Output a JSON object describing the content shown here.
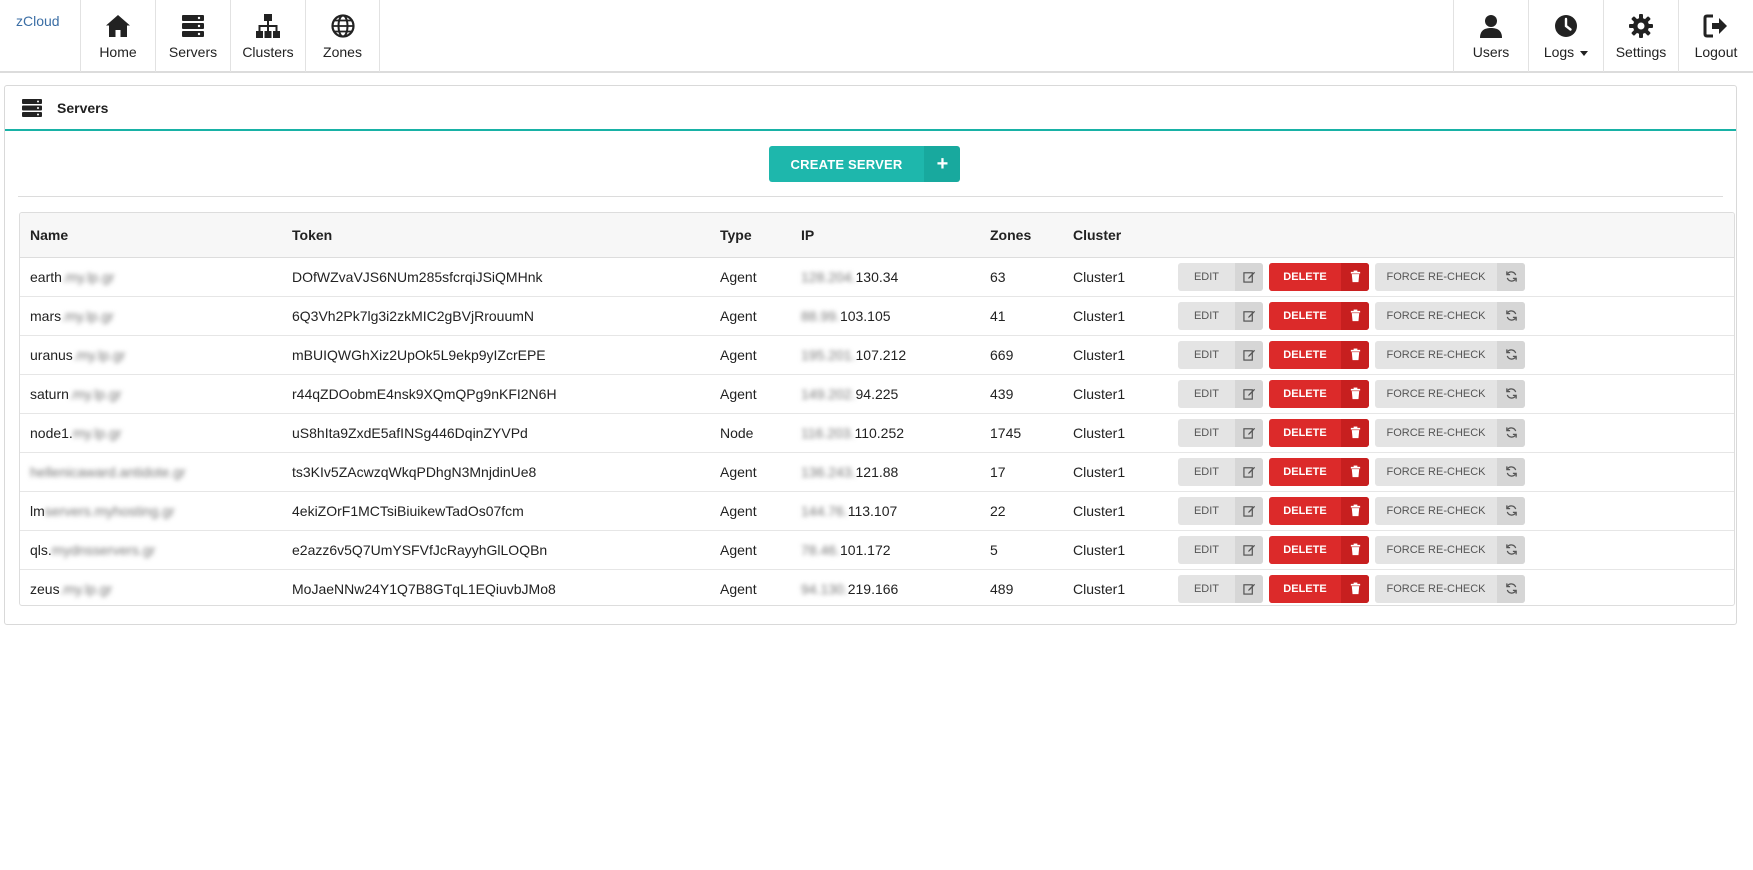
{
  "brand": "zCloud",
  "nav_left": [
    {
      "label": "Home",
      "icon": "home-icon"
    },
    {
      "label": "Servers",
      "icon": "servers-icon"
    },
    {
      "label": "Clusters",
      "icon": "clusters-icon"
    },
    {
      "label": "Zones",
      "icon": "globe-icon"
    }
  ],
  "nav_right": [
    {
      "label": "Users",
      "icon": "user-icon"
    },
    {
      "label": "Logs",
      "icon": "clock-icon"
    },
    {
      "label": "Settings",
      "icon": "gear-icon"
    },
    {
      "label": "Logout",
      "icon": "logout-icon"
    }
  ],
  "panel": {
    "title": "Servers",
    "icon": "servers-icon"
  },
  "create_button": {
    "label": "CREATE SERVER",
    "icon": "plus-icon"
  },
  "table": {
    "headers": [
      "Name",
      "Token",
      "Type",
      "IP",
      "Zones",
      "Cluster"
    ],
    "rows": [
      {
        "name": "earth",
        "name_blur": ".my.lp.gr",
        "token": "DOfWZvaVJS6NUm285sfcrqiJSiQMHnk",
        "type": "Agent",
        "ip_blur": "128.204.",
        "ip": "130.34",
        "zones": "63",
        "cluster": "Cluster1"
      },
      {
        "name": "mars",
        "name_blur": ".my.lp.gr",
        "token": "6Q3Vh2Pk7lg3i2zkMIC2gBVjRrouumN",
        "type": "Agent",
        "ip_blur": "88.99.",
        "ip": "103.105",
        "zones": "41",
        "cluster": "Cluster1"
      },
      {
        "name": "uranus",
        "name_blur": ".my.lp.gr",
        "token": "mBUIQWGhXiz2UpOk5L9ekp9yIZcrEPE",
        "type": "Agent",
        "ip_blur": "195.201.",
        "ip": "107.212",
        "zones": "669",
        "cluster": "Cluster1"
      },
      {
        "name": "saturn",
        "name_blur": ".my.lp.gr",
        "token": "r44qZDOobmE4nsk9XQmQPg9nKFI2N6H",
        "type": "Agent",
        "ip_blur": "149.202.",
        "ip": "94.225",
        "zones": "439",
        "cluster": "Cluster1"
      },
      {
        "name": "node1.",
        "name_blur": "my.lp.gr",
        "token": "uS8hIta9ZxdE5afINSg446DqinZYVPd",
        "type": "Node",
        "ip_blur": "116.203.",
        "ip": "110.252",
        "zones": "1745",
        "cluster": "Cluster1"
      },
      {
        "name": "",
        "name_blur": "hellenicaward.antidote.gr",
        "token": "ts3KIv5ZAcwzqWkqPDhgN3MnjdinUe8",
        "type": "Agent",
        "ip_blur": "136.243.",
        "ip": "121.88",
        "zones": "17",
        "cluster": "Cluster1"
      },
      {
        "name": "lm",
        "name_blur": "servers.myhosting.gr",
        "token": "4ekiZOrF1MCTsiBiuikewTadOs07fcm",
        "type": "Agent",
        "ip_blur": "144.76.",
        "ip": "113.107",
        "zones": "22",
        "cluster": "Cluster1"
      },
      {
        "name": "qls.",
        "name_blur": "mydnsservers.gr",
        "token": "e2azz6v5Q7UmYSFVfJcRayyhGlLOQBn",
        "type": "Agent",
        "ip_blur": "78.46.",
        "ip": "101.172",
        "zones": "5",
        "cluster": "Cluster1"
      },
      {
        "name": "zeus",
        "name_blur": ".my.lp.gr",
        "token": "MoJaeNNw24Y1Q7B8GTqL1EQiuvbJMo8",
        "type": "Agent",
        "ip_blur": "94.130.",
        "ip": "219.166",
        "zones": "489",
        "cluster": "Cluster1"
      }
    ],
    "actions": {
      "edit": "EDIT",
      "delete": "DELETE",
      "recheck": "FORCE RE-CHECK"
    }
  },
  "colors": {
    "accent": "#1eb7ac",
    "danger": "#dc2a2a",
    "brand": "#3b6ea5"
  }
}
